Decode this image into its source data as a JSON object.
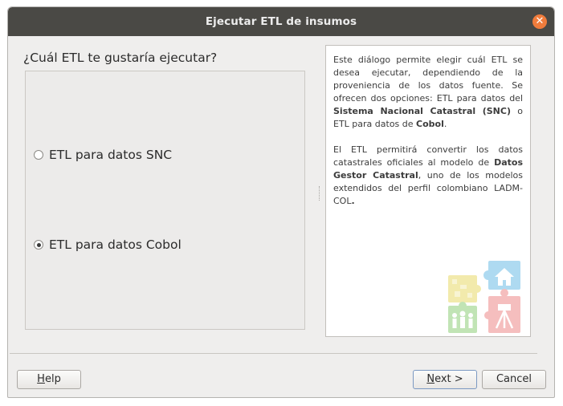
{
  "window": {
    "title": "Ejecutar ETL de insumos",
    "close_icon": "close-icon"
  },
  "main": {
    "question": "¿Cuál ETL te gustaría ejecutar?",
    "options": [
      {
        "label": "ETL para datos SNC",
        "checked": false
      },
      {
        "label": "ETL para datos Cobol",
        "checked": true
      }
    ]
  },
  "help": {
    "p1_a": "Este diálogo permite elegir cuál ETL se desea ejecutar, dependiendo de la proveniencia de los datos fuente. Se ofrecen dos opciones: ETL para datos del ",
    "p1_b": "Sistema Nacional Catastral (SNC)",
    "p1_c": " o ETL para datos de ",
    "p1_d": "Cobol",
    "p1_e": ".",
    "p2_a": "El ETL permitirá convertir los datos catastrales oficiales al modelo de ",
    "p2_b": "Datos Gestor Catastral",
    "p2_c": ", uno de los modelos extendidos del perfil colombiano LADM-COL",
    "p2_d": ".",
    "logo_icon": "puzzle-logo-icon"
  },
  "footer": {
    "help_label_u": "H",
    "help_label_rest": "elp",
    "next_label_u": "N",
    "next_label_rest": "ext >",
    "cancel_label": "Cancel"
  },
  "colors": {
    "titlebar": "#4a4945",
    "close": "#f07c3c",
    "dialog_bg": "#efeeed"
  }
}
